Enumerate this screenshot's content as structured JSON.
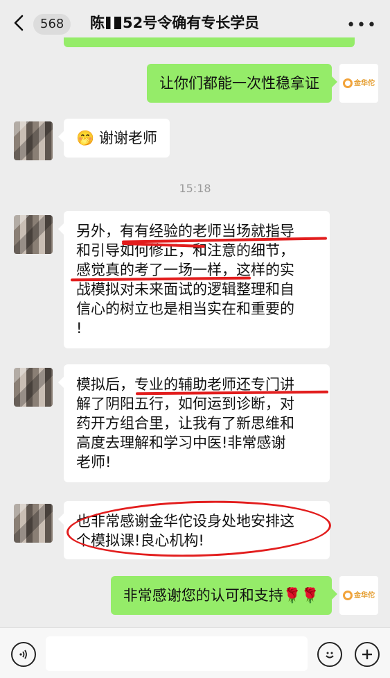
{
  "header": {
    "back_count": "568",
    "title_prefix": "陈",
    "title_suffix": "52号令确有专长学员",
    "more": "•••"
  },
  "messages": [
    {
      "side": "right",
      "sender": "brand",
      "text": "让你们都能一次性稳拿证"
    },
    {
      "side": "left",
      "sender": "person",
      "emoji": "🤭",
      "text": "谢谢老师"
    },
    {
      "type": "time",
      "text": "15:18"
    },
    {
      "side": "left",
      "sender": "person",
      "text": "另外，有有经验的老师当场就指导和引导如何修正，和注意的细节，感觉真的考了一场一样，这样的实战模拟对未来面试的逻辑整理和自信心的树立也是相当实在和重要的!"
    },
    {
      "side": "left",
      "sender": "person",
      "text": "模拟后，专业的辅助老师还专门讲解了阴阳五行，如何运到诊断，对药开方组合里，让我有了新思维和高度去理解和学习中医!非常感谢老师!"
    },
    {
      "side": "left",
      "sender": "person",
      "text": "也非常感谢金华佗设身处地安排这个模拟课!良心机构!"
    },
    {
      "side": "right",
      "sender": "brand",
      "text": "非常感谢您的认可和支持🌹🌹"
    }
  ],
  "lines": {
    "m4": [
      "另外，有有经验的老师当场就指导",
      "和引导如何修正，和注意的细节，",
      "感觉真的考了一场一样，这样的实",
      "战模拟对未来面试的逻辑整理和自",
      "信心的树立也是相当实在和重要的",
      "!"
    ],
    "m5": [
      "模拟后，专业的辅助老师还专门讲",
      "解了阴阳五行，如何运到诊断，对",
      "药开方组合里，让我有了新思维和",
      "高度去理解和学习中医!非常感谢",
      "老师!"
    ],
    "m6": [
      "也非常感谢金华佗设身处地安排这",
      "个模拟课!良心机构!"
    ]
  },
  "brand": {
    "logo_text": "金华佗",
    "accent": "#f2a33a"
  },
  "colors": {
    "green_bubble": "#95ec69",
    "annotation_red": "#e21d1d",
    "background": "#ededed"
  },
  "bottom": {
    "voice_icon": "voice-icon",
    "emoji_icon": "emoji-icon",
    "plus_icon": "plus-icon"
  }
}
